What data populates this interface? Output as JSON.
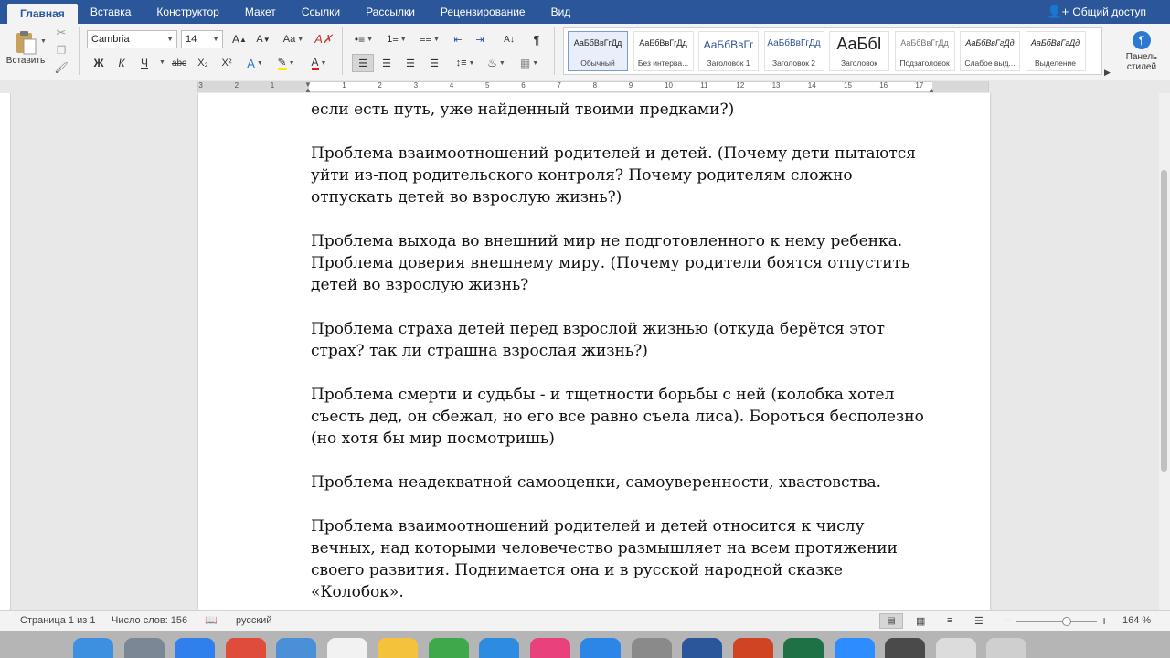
{
  "ribbon_tabs": [
    "Главная",
    "Вставка",
    "Конструктор",
    "Макет",
    "Ссылки",
    "Рассылки",
    "Рецензирование",
    "Вид"
  ],
  "share_label": "Общий доступ",
  "clipboard": {
    "paste_label": "Вставить"
  },
  "font": {
    "family": "Cambria",
    "size": "14"
  },
  "format_buttons": {
    "bold": "Ж",
    "italic": "К",
    "underline": "Ч",
    "strike": "abc",
    "subscript": "X₂",
    "superscript": "X²"
  },
  "styles_gallery": [
    {
      "sample": "АаБбВвГгДд",
      "name": "Обычный"
    },
    {
      "sample": "АаБбВвГгДд",
      "name": "Без интерва..."
    },
    {
      "sample": "АаБбВвГг",
      "name": "Заголовок 1"
    },
    {
      "sample": "АаБбВвГгДд",
      "name": "Заголовок 2"
    },
    {
      "sample": "АаБбI",
      "name": "Заголовок"
    },
    {
      "sample": "АаБбВвГгДд",
      "name": "Подзаголовок"
    },
    {
      "sample": "АаБбВвГгДд",
      "name": "Слабое выд..."
    },
    {
      "sample": "АаБбВвГгДд",
      "name": "Выделение"
    }
  ],
  "styles_pane_label": [
    "Панель",
    "стилей"
  ],
  "ruler_numbers": [
    "3",
    "2",
    "1",
    "1",
    "2",
    "3",
    "4",
    "5",
    "6",
    "7",
    "8",
    "9",
    "10",
    "11",
    "12",
    "13",
    "14",
    "15",
    "16",
    "17"
  ],
  "document": {
    "paragraphs": [
      [
        "если есть путь, уже найденный твоими предками?)"
      ],
      [
        "Проблема взаимоотношений родителей и детей. (Почему дети пытаются",
        "уйти из-под родительского контроля? Почему родителям сложно",
        "отпускать детей во взрослую жизнь?)"
      ],
      [
        "Проблема выхода во внешний мир не подготовленного к нему ребенка.",
        "Проблема доверия внешнему миру. (Почему родители боятся отпустить",
        "детей во взрослую жизнь?"
      ],
      [
        "Проблема страха детей перед взрослой жизнью (откуда берётся этот",
        "страх? так ли страшна взрослая жизнь?)"
      ],
      [
        "Проблема смерти и судьбы - и тщетности борьбы с ней (колобка хотел",
        "съесть дед, он сбежал, но его все равно съела лиса). Бороться бесполезно",
        "(но хотя бы мир посмотришь)"
      ],
      [
        "Проблема неадекватной самооценки, самоуверенности, хвастовства."
      ],
      [
        "Проблема взаимоотношений родителей и детей относится к числу",
        "вечных, над которыми человечество размышляет на всем протяжении",
        "своего развития. Поднимается она и в русской народной сказке",
        "«Колобок»."
      ]
    ]
  },
  "status_bar": {
    "page": "Страница 1 из 1",
    "words": "Число слов: 156",
    "language": "русский",
    "zoom": "164 %",
    "zoom_level": 0.62
  },
  "dock_apps": [
    {
      "name": "finder",
      "color": "#3d8fe0"
    },
    {
      "name": "launchpad",
      "color": "#7b8794"
    },
    {
      "name": "safari",
      "color": "#2f80ed"
    },
    {
      "name": "chrome",
      "color": "#e04c3c"
    },
    {
      "name": "mail",
      "color": "#4a90d9"
    },
    {
      "name": "calendar",
      "color": "#f2f2f2"
    },
    {
      "name": "notes",
      "color": "#f5c23b"
    },
    {
      "name": "numbers",
      "color": "#3ea84a"
    },
    {
      "name": "keynote",
      "color": "#2d8be0"
    },
    {
      "name": "itunes",
      "color": "#e8417b"
    },
    {
      "name": "app-store",
      "color": "#2b86e8"
    },
    {
      "name": "system-preferences",
      "color": "#8a8a8a"
    },
    {
      "name": "word",
      "color": "#2b579a"
    },
    {
      "name": "powerpoint",
      "color": "#d04423"
    },
    {
      "name": "excel",
      "color": "#1e7145"
    },
    {
      "name": "zoom",
      "color": "#2d8cff"
    },
    {
      "name": "quicktime",
      "color": "#4a4a4a"
    },
    {
      "name": "preview",
      "color": "#dcdcdc"
    },
    {
      "name": "trash",
      "color": "#cfcfcf"
    }
  ],
  "accent_color": "#2b579a"
}
